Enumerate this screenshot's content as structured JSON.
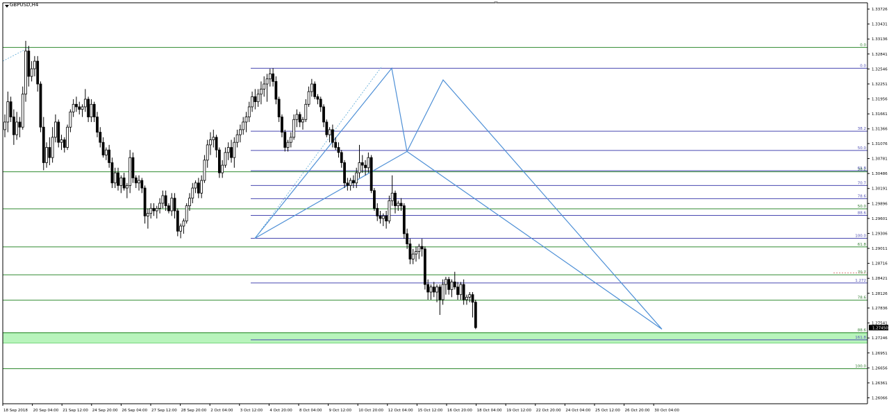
{
  "chart_data": {
    "type": "candlestick",
    "symbol_label": "GBPUSD,H4",
    "ylim": [
      1.2595,
      1.3385
    ],
    "y_ticks": [
      "1.33726",
      "1.33431",
      "1.33136",
      "1.32841",
      "1.32546",
      "1.32251",
      "1.31956",
      "1.31661",
      "1.31366",
      "1.31076",
      "1.30781",
      "1.30486",
      "1.30191",
      "1.29896",
      "1.29601",
      "1.29306",
      "1.29011",
      "1.28716",
      "1.28421",
      "1.28126",
      "1.27836",
      "1.27541",
      "1.27246",
      "1.26951",
      "1.26656",
      "1.26361",
      "1.26066"
    ],
    "current_price": "1.27450",
    "x_labels": [
      "18 Sep 2018",
      "20 Sep 04:00",
      "21 Sep 12:00",
      "24 Sep 20:00",
      "26 Sep 04:00",
      "27 Sep 12:00",
      "28 Sep 20:00",
      "2 Oct 04:00",
      "3 Oct 12:00",
      "4 Oct 20:00",
      "8 Oct 04:00",
      "9 Oct 12:00",
      "10 Oct 20:00",
      "12 Oct 04:00",
      "15 Oct 12:00",
      "16 Oct 20:00",
      "18 Oct 04:00",
      "19 Oct 12:00",
      "22 Oct 20:00",
      "24 Oct 04:00",
      "25 Oct 12:00",
      "26 Oct 20:00",
      "30 Oct 04:00"
    ],
    "green_fib_levels": [
      {
        "label": "0.0",
        "price": 1.3297
      },
      {
        "label": "38.2",
        "price": 1.3052
      },
      {
        "label": "50.0",
        "price": 1.2979
      },
      {
        "label": "61.8",
        "price": 1.2904
      },
      {
        "label": "70.7",
        "price": 1.2849
      },
      {
        "label": "78.6",
        "price": 1.2799
      },
      {
        "label": "88.6",
        "price": 1.2735
      },
      {
        "label": "100.0",
        "price": 1.2664
      }
    ],
    "blue_fib_levels": [
      {
        "label": "0.0",
        "price": 1.3256
      },
      {
        "label": "38.2",
        "price": 1.3132
      },
      {
        "label": "50.0",
        "price": 1.3094
      },
      {
        "label": "61.8",
        "price": 1.3054
      },
      {
        "label": "70.7",
        "price": 1.3025
      },
      {
        "label": "78.6",
        "price": 1.2999
      },
      {
        "label": "88.6",
        "price": 1.2966
      },
      {
        "label": "100.0",
        "price": 1.2921
      },
      {
        "label": "1.272",
        "price": 1.2833
      },
      {
        "label": "161.8",
        "price": 1.2721
      }
    ],
    "target_zone": {
      "from": 1.27145,
      "to": 1.27345
    },
    "dotted_level": {
      "label": "70.7",
      "price": 1.2853
    },
    "candles": [
      [
        1.3135,
        1.3165,
        1.312,
        1.315
      ],
      [
        1.315,
        1.321,
        1.313,
        1.319
      ],
      [
        1.319,
        1.32,
        1.315,
        1.316
      ],
      [
        1.316,
        1.3175,
        1.3105,
        1.3125
      ],
      [
        1.3125,
        1.317,
        1.3115,
        1.315
      ],
      [
        1.315,
        1.316,
        1.312,
        1.314
      ],
      [
        1.314,
        1.322,
        1.3135,
        1.3205
      ],
      [
        1.3205,
        1.331,
        1.319,
        1.329
      ],
      [
        1.329,
        1.33,
        1.322,
        1.324
      ],
      [
        1.324,
        1.327,
        1.323,
        1.3255
      ],
      [
        1.3255,
        1.328,
        1.324,
        1.327
      ],
      [
        1.327,
        1.328,
        1.321,
        1.3225
      ],
      [
        1.3225,
        1.323,
        1.313,
        1.314
      ],
      [
        1.314,
        1.316,
        1.3055,
        1.307
      ],
      [
        1.307,
        1.311,
        1.306,
        1.31
      ],
      [
        1.31,
        1.312,
        1.3065,
        1.308
      ],
      [
        1.308,
        1.314,
        1.307,
        1.312
      ],
      [
        1.312,
        1.3165,
        1.311,
        1.315
      ],
      [
        1.315,
        1.3155,
        1.31,
        1.311
      ],
      [
        1.311,
        1.3125,
        1.3095,
        1.3115
      ],
      [
        1.3115,
        1.312,
        1.309,
        1.31
      ],
      [
        1.31,
        1.3145,
        1.3095,
        1.314
      ],
      [
        1.314,
        1.3175,
        1.313,
        1.317
      ],
      [
        1.317,
        1.3195,
        1.316,
        1.3185
      ],
      [
        1.3185,
        1.32,
        1.317,
        1.318
      ],
      [
        1.318,
        1.319,
        1.3165,
        1.3175
      ],
      [
        1.3175,
        1.3185,
        1.316,
        1.318
      ],
      [
        1.318,
        1.3215,
        1.317,
        1.3195
      ],
      [
        1.3195,
        1.32,
        1.315,
        1.316
      ],
      [
        1.316,
        1.3195,
        1.315,
        1.3185
      ],
      [
        1.3185,
        1.319,
        1.315,
        1.316
      ],
      [
        1.316,
        1.317,
        1.312,
        1.313
      ],
      [
        1.313,
        1.314,
        1.31,
        1.311
      ],
      [
        1.311,
        1.312,
        1.308,
        1.3085
      ],
      [
        1.3085,
        1.31,
        1.3075,
        1.3095
      ],
      [
        1.3095,
        1.3105,
        1.306,
        1.307
      ],
      [
        1.307,
        1.308,
        1.302,
        1.303
      ],
      [
        1.303,
        1.306,
        1.302,
        1.305
      ],
      [
        1.305,
        1.306,
        1.3015,
        1.3025
      ],
      [
        1.3025,
        1.3045,
        1.301,
        1.304
      ],
      [
        1.304,
        1.305,
        1.3015,
        1.302
      ],
      [
        1.302,
        1.303,
        1.3,
        1.3025
      ],
      [
        1.3025,
        1.3095,
        1.301,
        1.308
      ],
      [
        1.308,
        1.309,
        1.303,
        1.304
      ],
      [
        1.304,
        1.3045,
        1.302,
        1.303
      ],
      [
        1.303,
        1.3045,
        1.3015,
        1.3035
      ],
      [
        1.3035,
        1.304,
        1.301,
        1.302
      ],
      [
        1.302,
        1.3025,
        1.295,
        1.2965
      ],
      [
        1.2965,
        1.298,
        1.294,
        1.297
      ],
      [
        1.297,
        1.299,
        1.296,
        1.298
      ],
      [
        1.298,
        1.299,
        1.2965,
        1.2975
      ],
      [
        1.2975,
        1.2985,
        1.296,
        1.298
      ],
      [
        1.298,
        1.3,
        1.297,
        1.299
      ],
      [
        1.299,
        1.3015,
        1.298,
        1.3005
      ],
      [
        1.3005,
        1.3015,
        1.2975,
        1.2985
      ],
      [
        1.2985,
        1.299,
        1.297,
        1.2975
      ],
      [
        1.2975,
        1.301,
        1.2965,
        1.3
      ],
      [
        1.3,
        1.301,
        1.296,
        1.2975
      ],
      [
        1.2975,
        1.298,
        1.2925,
        1.2935
      ],
      [
        1.2935,
        1.295,
        1.2921,
        1.2945
      ],
      [
        1.2945,
        1.296,
        1.293,
        1.2955
      ],
      [
        1.2955,
        1.299,
        1.295,
        1.2985
      ],
      [
        1.2985,
        1.301,
        1.2975,
        1.3
      ],
      [
        1.3,
        1.303,
        1.299,
        1.302
      ],
      [
        1.302,
        1.3035,
        1.301,
        1.303
      ],
      [
        1.303,
        1.304,
        1.3,
        1.301
      ],
      [
        1.301,
        1.3045,
        1.3,
        1.3035
      ],
      [
        1.3035,
        1.3085,
        1.303,
        1.3075
      ],
      [
        1.3075,
        1.3115,
        1.306,
        1.3105
      ],
      [
        1.3105,
        1.313,
        1.3085,
        1.3115
      ],
      [
        1.3115,
        1.3135,
        1.31,
        1.312
      ],
      [
        1.312,
        1.3125,
        1.308,
        1.3095
      ],
      [
        1.3095,
        1.31,
        1.304,
        1.305
      ],
      [
        1.305,
        1.3075,
        1.304,
        1.3065
      ],
      [
        1.3065,
        1.31,
        1.306,
        1.309
      ],
      [
        1.309,
        1.311,
        1.3075,
        1.31
      ],
      [
        1.31,
        1.3115,
        1.307,
        1.308
      ],
      [
        1.308,
        1.312,
        1.306,
        1.311
      ],
      [
        1.311,
        1.3135,
        1.31,
        1.3125
      ],
      [
        1.3125,
        1.3145,
        1.311,
        1.3135
      ],
      [
        1.3135,
        1.316,
        1.3125,
        1.315
      ],
      [
        1.315,
        1.317,
        1.313,
        1.316
      ],
      [
        1.316,
        1.319,
        1.315,
        1.318
      ],
      [
        1.318,
        1.321,
        1.317,
        1.32
      ],
      [
        1.32,
        1.3215,
        1.3175,
        1.319
      ],
      [
        1.319,
        1.3215,
        1.318,
        1.3205
      ],
      [
        1.3205,
        1.323,
        1.3185,
        1.3215
      ],
      [
        1.3215,
        1.324,
        1.32,
        1.3225
      ],
      [
        1.3225,
        1.3245,
        1.319,
        1.3235
      ],
      [
        1.3235,
        1.3255,
        1.322,
        1.3245
      ],
      [
        1.3245,
        1.3256,
        1.322,
        1.323
      ],
      [
        1.323,
        1.324,
        1.3185,
        1.3195
      ],
      [
        1.3195,
        1.32,
        1.315,
        1.316
      ],
      [
        1.316,
        1.3165,
        1.312,
        1.313
      ],
      [
        1.313,
        1.3135,
        1.3092,
        1.31
      ],
      [
        1.31,
        1.3115,
        1.3092,
        1.311
      ],
      [
        1.311,
        1.313,
        1.31,
        1.312
      ],
      [
        1.312,
        1.3165,
        1.3115,
        1.3155
      ],
      [
        1.3155,
        1.3175,
        1.314,
        1.3165
      ],
      [
        1.3165,
        1.317,
        1.314,
        1.315
      ],
      [
        1.315,
        1.316,
        1.3135,
        1.3155
      ],
      [
        1.3155,
        1.3195,
        1.315,
        1.3185
      ],
      [
        1.3185,
        1.322,
        1.318,
        1.321
      ],
      [
        1.321,
        1.3235,
        1.32,
        1.3225
      ],
      [
        1.3225,
        1.323,
        1.3195,
        1.32
      ],
      [
        1.32,
        1.3205,
        1.3185,
        1.3195
      ],
      [
        1.3195,
        1.32,
        1.317,
        1.318
      ],
      [
        1.318,
        1.3185,
        1.314,
        1.315
      ],
      [
        1.315,
        1.3155,
        1.312,
        1.3125
      ],
      [
        1.3125,
        1.314,
        1.311,
        1.3135
      ],
      [
        1.3135,
        1.3145,
        1.31,
        1.311
      ],
      [
        1.311,
        1.312,
        1.3095,
        1.31
      ],
      [
        1.31,
        1.311,
        1.308,
        1.309
      ],
      [
        1.309,
        1.3095,
        1.306,
        1.307
      ],
      [
        1.307,
        1.3075,
        1.302,
        1.303
      ],
      [
        1.303,
        1.304,
        1.3015,
        1.3025
      ],
      [
        1.3025,
        1.304,
        1.3015,
        1.3035
      ],
      [
        1.3035,
        1.3045,
        1.302,
        1.303
      ],
      [
        1.303,
        1.306,
        1.302,
        1.305
      ],
      [
        1.305,
        1.3105,
        1.304,
        1.307
      ],
      [
        1.307,
        1.3085,
        1.305,
        1.3065
      ],
      [
        1.3065,
        1.3075,
        1.3045,
        1.306
      ],
      [
        1.306,
        1.309,
        1.305,
        1.308
      ],
      [
        1.308,
        1.3085,
        1.301,
        1.3015
      ],
      [
        1.3015,
        1.302,
        1.2975,
        1.298
      ],
      [
        1.298,
        1.299,
        1.2955,
        1.2965
      ],
      [
        1.2965,
        1.2975,
        1.295,
        1.296
      ],
      [
        1.296,
        1.297,
        1.2945,
        1.2965
      ],
      [
        1.2965,
        1.2975,
        1.294,
        1.2955
      ],
      [
        1.2955,
        1.3005,
        1.295,
        1.2995
      ],
      [
        1.2995,
        1.3045,
        1.2985,
        1.301
      ],
      [
        1.301,
        1.3015,
        1.297,
        1.2985
      ],
      [
        1.2985,
        1.2995,
        1.2975,
        1.299
      ],
      [
        1.299,
        1.3,
        1.2975,
        1.2985
      ],
      [
        1.2985,
        1.299,
        1.292,
        1.293
      ],
      [
        1.293,
        1.294,
        1.29,
        1.291
      ],
      [
        1.291,
        1.292,
        1.287,
        1.288
      ],
      [
        1.288,
        1.29,
        1.287,
        1.289
      ],
      [
        1.289,
        1.2905,
        1.2875,
        1.2895
      ],
      [
        1.2895,
        1.291,
        1.288,
        1.2905
      ],
      [
        1.2905,
        1.292,
        1.2885,
        1.29
      ],
      [
        1.29,
        1.2905,
        1.282,
        1.283
      ],
      [
        1.283,
        1.284,
        1.28,
        1.2815
      ],
      [
        1.2815,
        1.283,
        1.28,
        1.2825
      ],
      [
        1.2825,
        1.2835,
        1.2805,
        1.2815
      ],
      [
        1.2815,
        1.283,
        1.2795,
        1.2825
      ],
      [
        1.2825,
        1.283,
        1.277,
        1.28
      ],
      [
        1.28,
        1.284,
        1.279,
        1.283
      ],
      [
        1.283,
        1.2845,
        1.281,
        1.284
      ],
      [
        1.284,
        1.2845,
        1.281,
        1.282
      ],
      [
        1.282,
        1.284,
        1.2805,
        1.2835
      ],
      [
        1.2835,
        1.2855,
        1.282,
        1.2825
      ],
      [
        1.2825,
        1.2835,
        1.28,
        1.281
      ],
      [
        1.281,
        1.2835,
        1.28,
        1.283
      ],
      [
        1.283,
        1.284,
        1.279,
        1.28
      ],
      [
        1.28,
        1.281,
        1.279,
        1.2805
      ],
      [
        1.2805,
        1.2815,
        1.2795,
        1.281
      ],
      [
        1.281,
        1.2815,
        1.2765,
        1.2795
      ],
      [
        1.2795,
        1.28,
        1.2742,
        1.2745
      ]
    ]
  }
}
